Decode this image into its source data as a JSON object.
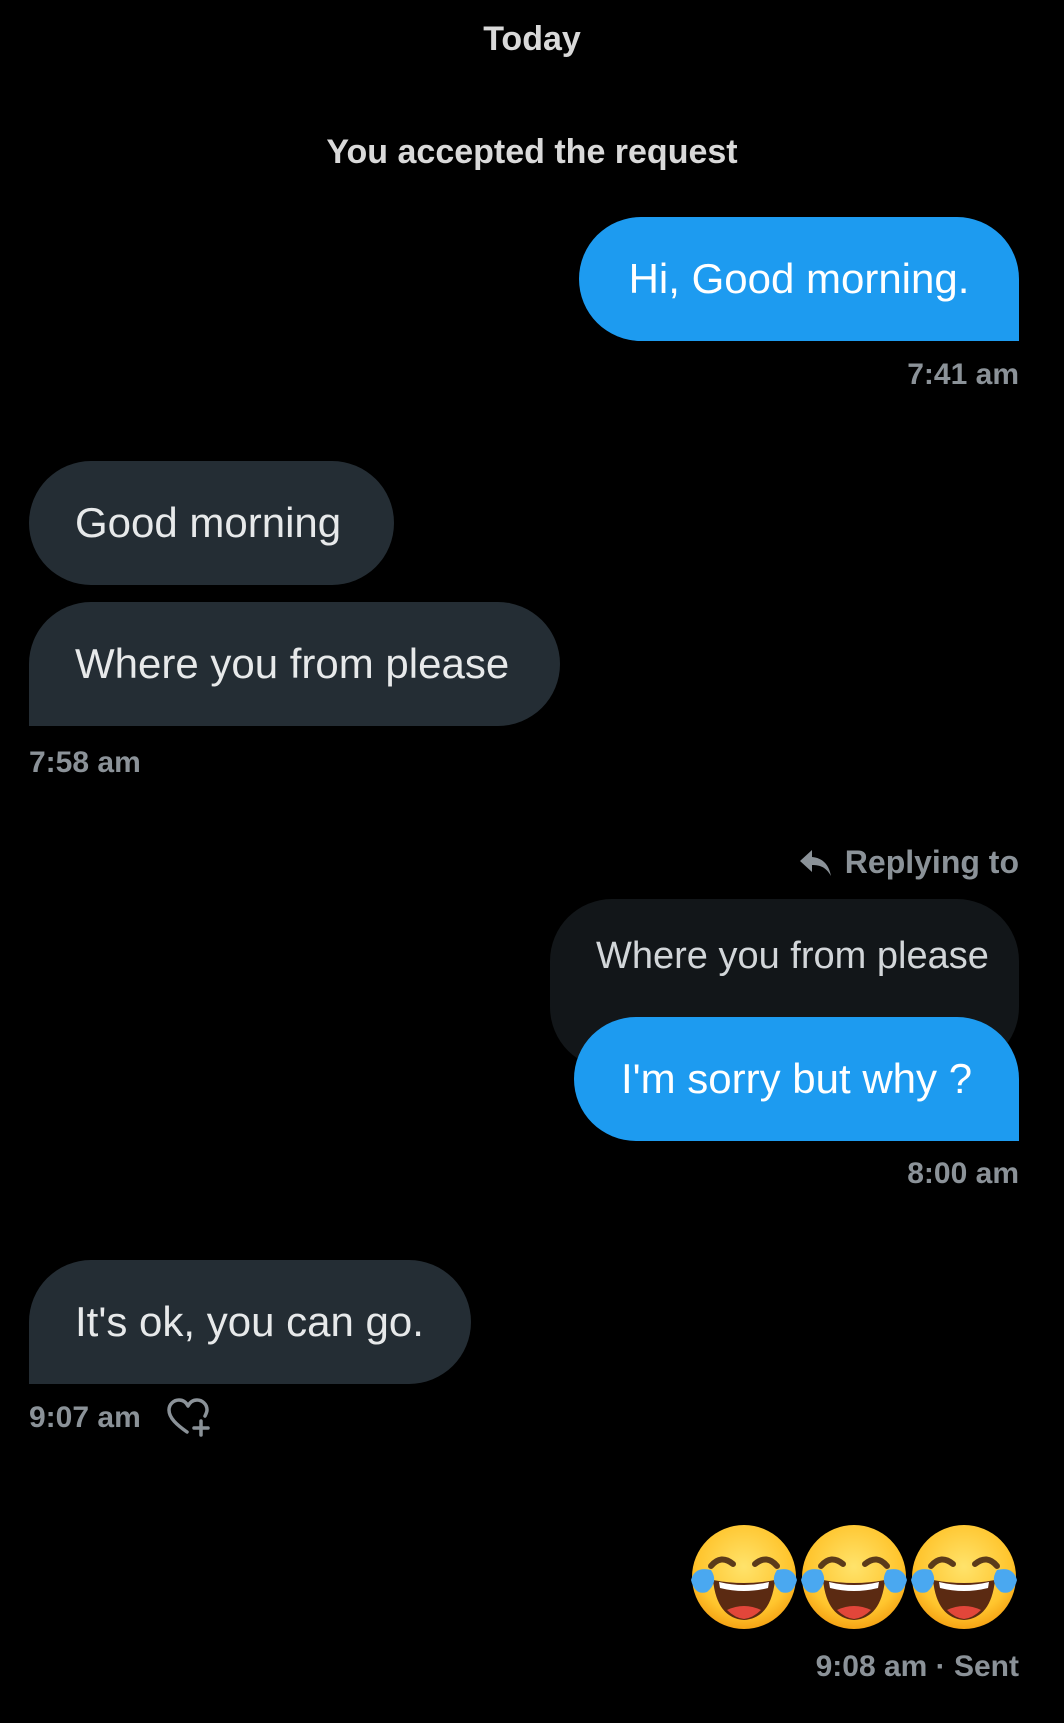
{
  "header": {
    "day": "Today",
    "system_note": "You accepted the request"
  },
  "messages": [
    {
      "direction": "out",
      "text": "Hi, Good morning.",
      "time": "7:41 am"
    },
    {
      "direction": "in",
      "text": "Good morning"
    },
    {
      "direction": "in",
      "text": "Where you from please",
      "time": "7:58 am"
    },
    {
      "direction": "out",
      "replying_label": "Replying to",
      "quoted_text": "Where you from please",
      "text": "I'm sorry but why ?",
      "time": "8:00 am"
    },
    {
      "direction": "in",
      "text": "It's ok, you can go.",
      "time": "9:07 am",
      "reaction_icon": "heart-plus-icon"
    },
    {
      "direction": "out",
      "emoji": [
        "face-with-tears-of-joy",
        "face-with-tears-of-joy",
        "face-with-tears-of-joy"
      ],
      "time": "9:08 am · Sent"
    }
  ],
  "colors": {
    "background": "#000000",
    "outgoing_bubble": "#1d9bf0",
    "incoming_bubble": "#242d34",
    "quoted_bubble": "#121619",
    "muted_text": "#8b9298"
  },
  "icons": {
    "reply": "reply-arrow-icon",
    "reaction": "heart-plus-icon",
    "emoji": "face-with-tears-of-joy"
  }
}
